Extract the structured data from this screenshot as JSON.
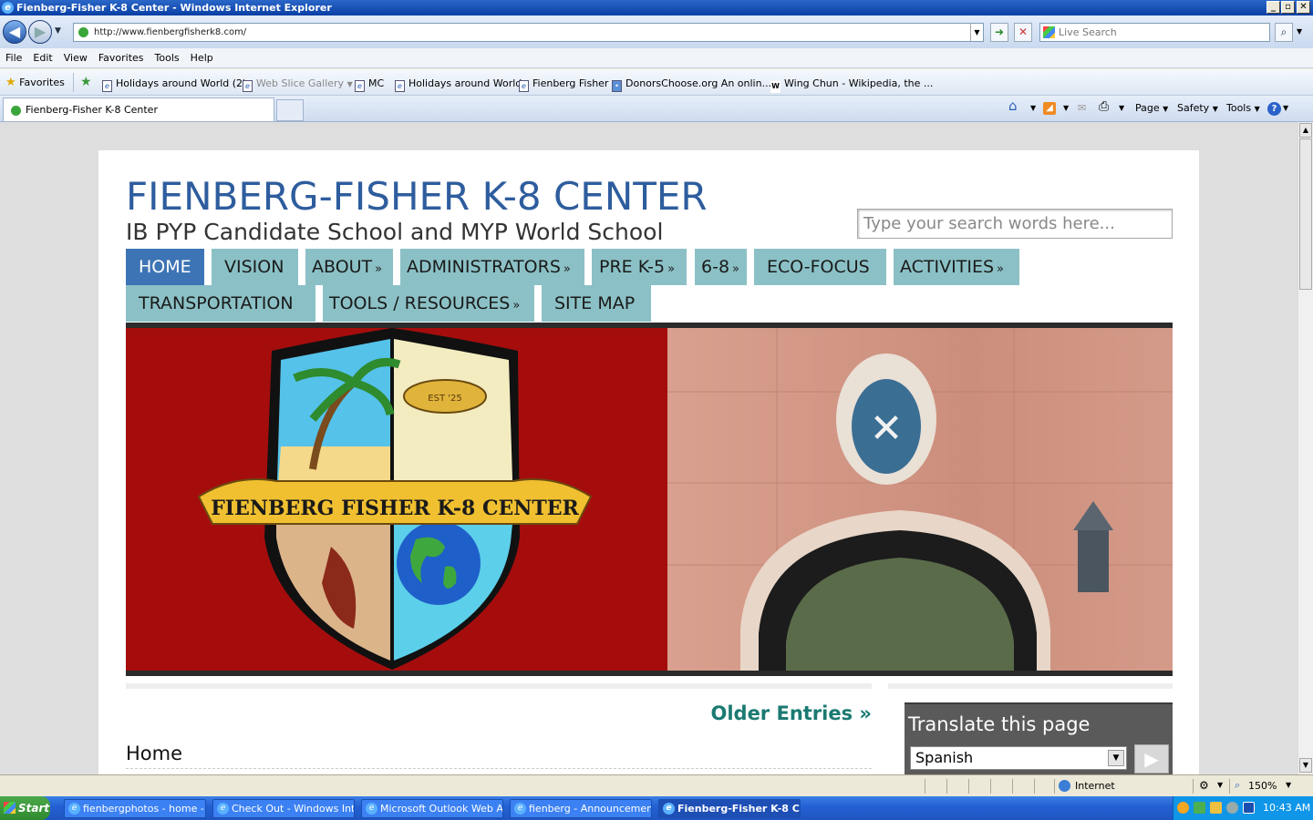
{
  "window": {
    "title": "Fienberg-Fisher K-8 Center - Windows Internet Explorer"
  },
  "address": {
    "url": "http://www.fienbergfisherk8.com/",
    "search_placeholder": "Live Search"
  },
  "menu": [
    "File",
    "Edit",
    "View",
    "Favorites",
    "Tools",
    "Help"
  ],
  "favorites": {
    "label": "Favorites",
    "items": [
      "Holidays around World (2)",
      "Web Slice Gallery",
      "MC",
      "Holidays around World",
      "Fienberg Fisher",
      "DonorsChoose.org An onlin...",
      "Wing Chun - Wikipedia, the ..."
    ]
  },
  "tabs": [
    {
      "label": "Fienberg-Fisher K-8 Center"
    }
  ],
  "commandbar": {
    "page": "Page",
    "safety": "Safety",
    "tools": "Tools"
  },
  "site": {
    "title": "FIENBERG-FISHER K-8 CENTER",
    "subtitle": "IB PYP Candidate School and MYP World School",
    "search_placeholder": "Type your search words here...",
    "nav": [
      "HOME",
      "VISION",
      "ABOUT",
      "ADMINISTRATORS",
      "PRE K-5",
      "6-8",
      "ECO-FOCUS",
      "ACTIVITIES",
      "TRANSPORTATION",
      "TOOLS / RESOURCES",
      "SITE MAP"
    ],
    "crest_text": "FIENBERG FISHER K-8 CENTER",
    "lamp_text": "EST '25",
    "older_entries": "Older Entries »",
    "post_title": "Home",
    "translate": {
      "heading": "Translate this page",
      "language": "Spanish"
    }
  },
  "status": {
    "zone": "Internet",
    "zoom": "150%"
  },
  "taskbar": {
    "start": "Start",
    "items": [
      "fienbergphotos - home - ...",
      "Check Out - Windows Int...",
      "Microsoft Outlook Web A...",
      "fienberg - Announcemen...",
      "Fienberg-Fisher K-8 C..."
    ],
    "clock": "10:43 AM"
  }
}
